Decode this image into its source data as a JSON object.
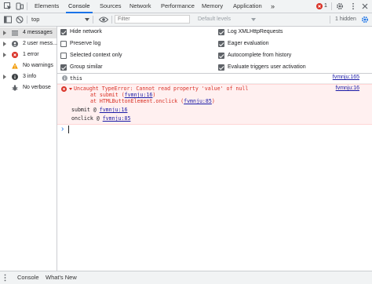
{
  "tabs": {
    "items": [
      "Elements",
      "Console",
      "Sources",
      "Network",
      "Performance",
      "Memory",
      "Application"
    ],
    "more": "»",
    "error_badge": "1",
    "active": "Console"
  },
  "toolbar": {
    "context": "top",
    "filter_placeholder": "Filter",
    "levels": "Default levels",
    "hidden": "1 hidden"
  },
  "sidebar": {
    "items": [
      {
        "label": "4 messages",
        "icon": "list-icon"
      },
      {
        "label": "2 user mess...",
        "icon": "user-icon"
      },
      {
        "label": "1 error",
        "icon": "error-icon"
      },
      {
        "label": "No warnings",
        "icon": "warning-icon"
      },
      {
        "label": "3 info",
        "icon": "info-icon"
      },
      {
        "label": "No verbose",
        "icon": "bug-icon"
      }
    ]
  },
  "settings": {
    "left": [
      {
        "label": "Hide network",
        "checked": true
      },
      {
        "label": "Preserve log",
        "checked": false
      },
      {
        "label": "Selected context only",
        "checked": false
      },
      {
        "label": "Group similar",
        "checked": true
      }
    ],
    "right": [
      {
        "label": "Log XMLHttpRequests",
        "checked": true
      },
      {
        "label": "Eager evaluation",
        "checked": true
      },
      {
        "label": "Autocomplete from history",
        "checked": true
      },
      {
        "label": "Evaluate triggers user activation",
        "checked": true
      }
    ]
  },
  "console": {
    "log_text": "this",
    "log_source": "fvmnju:165",
    "error_main": "Uncaught TypeError: Cannot read property 'value' of null",
    "error_source": "fvmnju:16",
    "stack1_prefix": "at submit (",
    "stack1_link": "fvmnju:16",
    "stack1_suffix": ")",
    "stack2_prefix": "at HTMLButtonElement.onclick (",
    "stack2_link": "fvmnju:85",
    "stack2_suffix": ")",
    "trace1_prefix": "submit @ ",
    "trace1_link": "fvmnju:16",
    "trace2_prefix": "onclick @ ",
    "trace2_link": "fvmnju:85",
    "prompt": "›"
  },
  "drawer": {
    "tabs": [
      "Console",
      "What's New"
    ]
  },
  "colors": {
    "accent": "#1a73e8",
    "error": "#d93025",
    "link": "#1a1aa6"
  }
}
